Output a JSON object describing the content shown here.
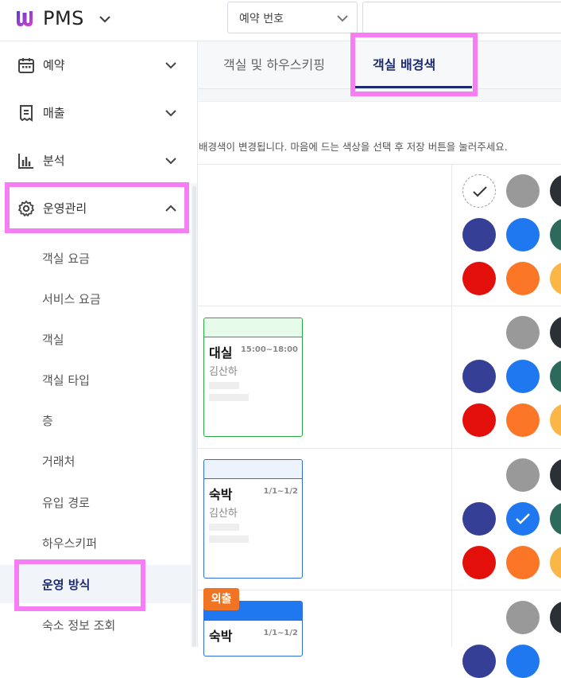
{
  "header": {
    "brand": "PMS",
    "select_value": "예약 번호"
  },
  "sidebar": {
    "menu": [
      {
        "label": "예약"
      },
      {
        "label": "매출"
      },
      {
        "label": "분석"
      },
      {
        "label": "운영관리"
      }
    ],
    "sub_items": [
      {
        "label": "객실 요금"
      },
      {
        "label": "서비스 요금"
      },
      {
        "label": "객실"
      },
      {
        "label": "객실 타입"
      },
      {
        "label": "층"
      },
      {
        "label": "거래처"
      },
      {
        "label": "유입 경로"
      },
      {
        "label": "하우스키퍼"
      },
      {
        "label": "운영 방식"
      },
      {
        "label": "숙소 정보 조회"
      }
    ]
  },
  "tabs": [
    {
      "label": "객실 및 하우스키핑"
    },
    {
      "label": "객실 배경색"
    }
  ],
  "description": "배경색이 변경됩니다. 마음에 드는 색상을 선택 후 저장 버튼을 눌러주세요.",
  "cards": [
    {
      "type": "대실",
      "time": "15:00~18:00",
      "guest": "김산하"
    },
    {
      "type": "숙박",
      "time": "1/1~1/2",
      "guest": "김산하"
    },
    {
      "type": "숙박",
      "time": "1/1~1/2",
      "badge": "외출"
    }
  ],
  "colors": {
    "gray": "#999999",
    "dark": "#2b2f36",
    "indigo": "#363f96",
    "blue": "#1f78ef",
    "teal": "#2d6a5c",
    "red": "#e20f0a",
    "orange": "#fb7627",
    "yellow": "#fbb648",
    "accent_navy": "#1d2c6e",
    "highlight_pink": "#f77df4",
    "daesil_border": "#28a745",
    "daesil_header": "#e7fbea",
    "sukbak_border": "#2f6fd6",
    "sukbak_header": "#edf3fd",
    "outing_header": "#1f78ef",
    "outing_badge": "#f07423"
  }
}
